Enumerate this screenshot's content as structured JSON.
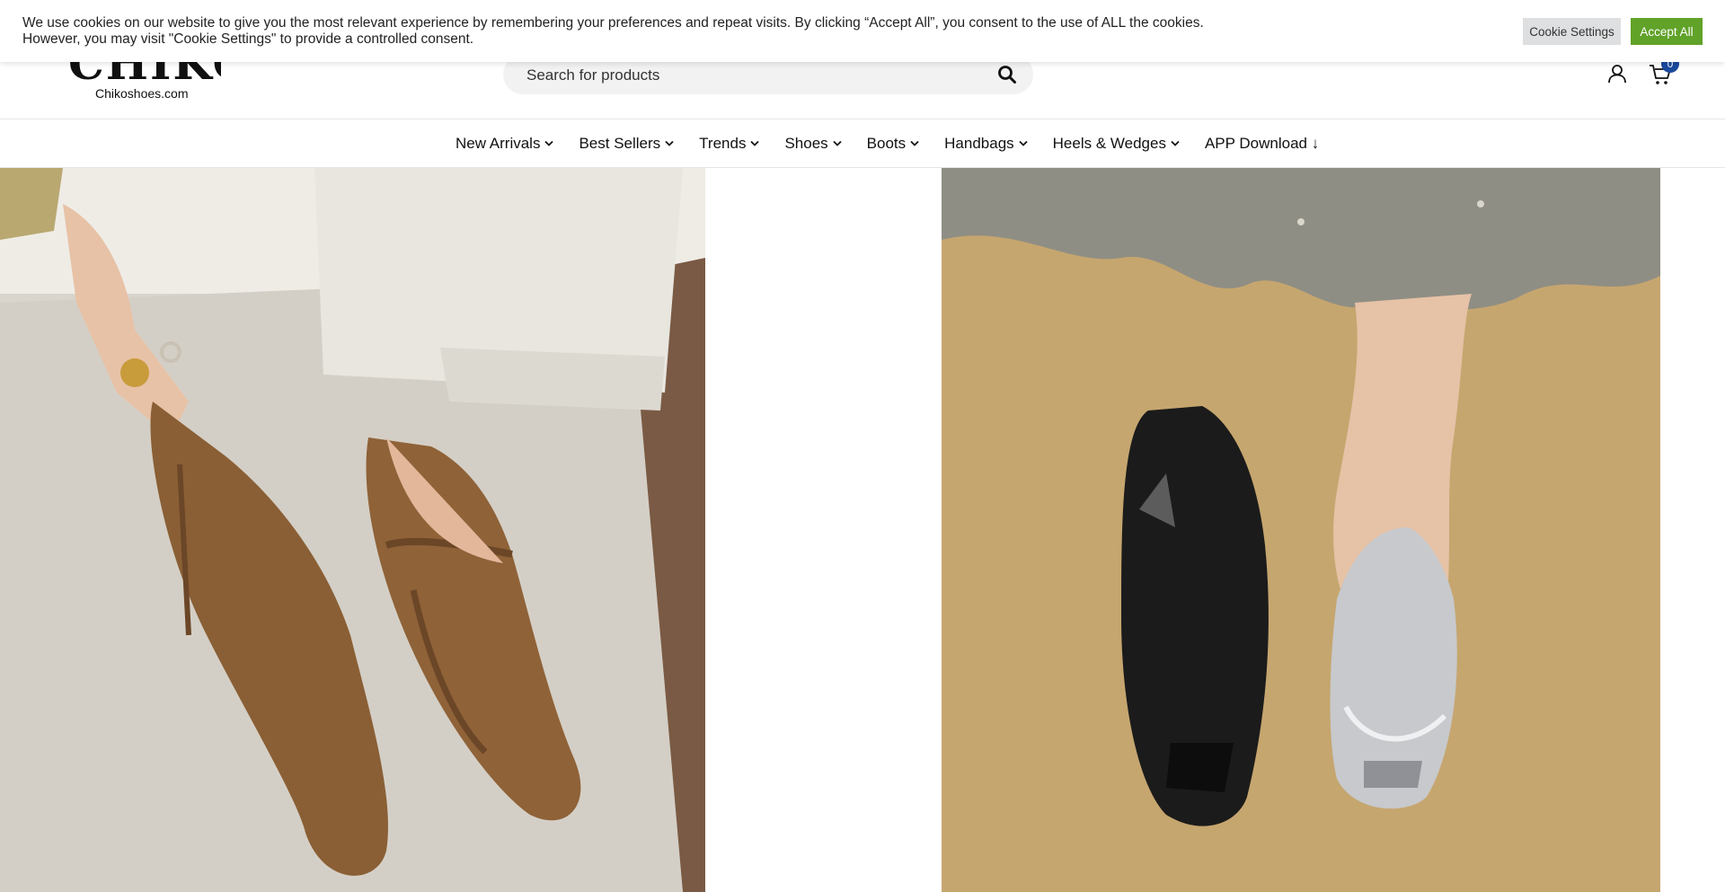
{
  "cookie_banner": {
    "message": "We use cookies on our website to give you the most relevant experience by remembering your preferences and repeat visits. By clicking “Accept All”, you consent to the use of ALL the cookies. However, you may visit \"Cookie Settings\" to provide a controlled consent.",
    "settings_label": "Cookie Settings",
    "accept_label": "Accept All"
  },
  "header": {
    "logo_text": "CHIKO",
    "logo_subtext": "Chikoshoes.com",
    "search": {
      "placeholder": "Search for products",
      "value": ""
    },
    "cart_count": "0",
    "icons": [
      "search-icon",
      "user-icon",
      "cart-icon"
    ]
  },
  "nav": {
    "items": [
      {
        "label": "New Arrivals"
      },
      {
        "label": "Best Sellers"
      },
      {
        "label": "Trends"
      },
      {
        "label": "Shoes"
      },
      {
        "label": "Boots"
      },
      {
        "label": "Handbags"
      },
      {
        "label": "Heels & Wedges"
      },
      {
        "label": "APP Download ↓"
      }
    ]
  },
  "colors": {
    "accept_green": "#61a229",
    "settings_gray": "#dedfe0",
    "badge_blue": "#1b4a9c",
    "search_bg": "#f2f2f2"
  }
}
